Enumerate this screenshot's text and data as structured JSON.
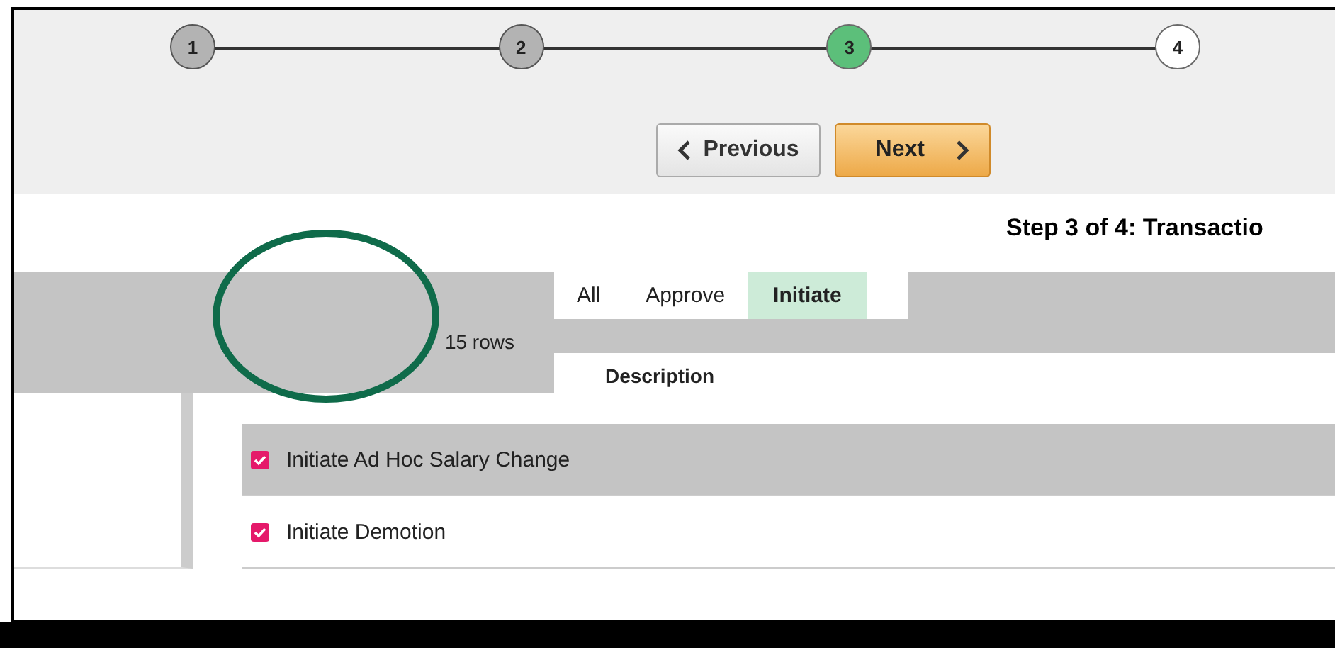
{
  "stepper": {
    "steps": [
      {
        "number": "1",
        "completed": true,
        "current": false
      },
      {
        "number": "2",
        "completed": true,
        "current": false
      },
      {
        "number": "3",
        "completed": false,
        "current": true
      },
      {
        "number": "4",
        "completed": false,
        "current": false
      }
    ]
  },
  "navigation": {
    "previous": "Previous",
    "next": "Next"
  },
  "step_title": "Step 3 of 4: Transactio",
  "row_count": "15 rows",
  "tabs": [
    {
      "label": "All",
      "selected": false
    },
    {
      "label": "Approve",
      "selected": false
    },
    {
      "label": "Initiate",
      "selected": true
    }
  ],
  "table": {
    "columns": [
      "Description"
    ],
    "rows": [
      {
        "checked": true,
        "selected": true,
        "description": "Initiate Ad Hoc Salary Change"
      },
      {
        "checked": true,
        "selected": false,
        "description": "Initiate Demotion"
      }
    ]
  }
}
